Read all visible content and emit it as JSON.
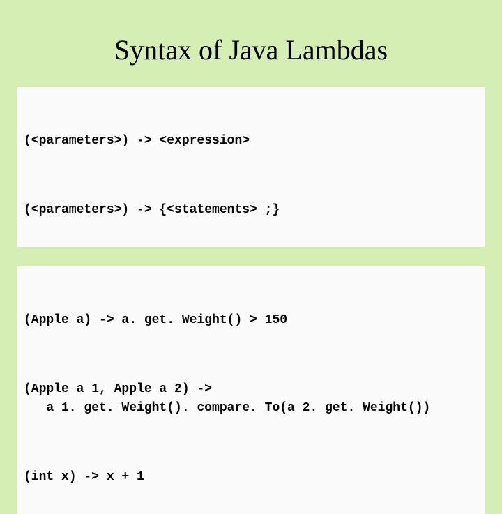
{
  "title": "Syntax of Java Lambdas",
  "block1": {
    "line1": "(<parameters>) -> <expression>",
    "line2": "(<parameters>) -> {<statements> ;}"
  },
  "block2": {
    "line1": "(Apple a) -> a. get. Weight() > 150",
    "line2": "(Apple a 1, Apple a 2) ->\n   a 1. get. Weight(). compare. To(a 2. get. Weight())",
    "line3": "(int x) -> x + 1"
  }
}
